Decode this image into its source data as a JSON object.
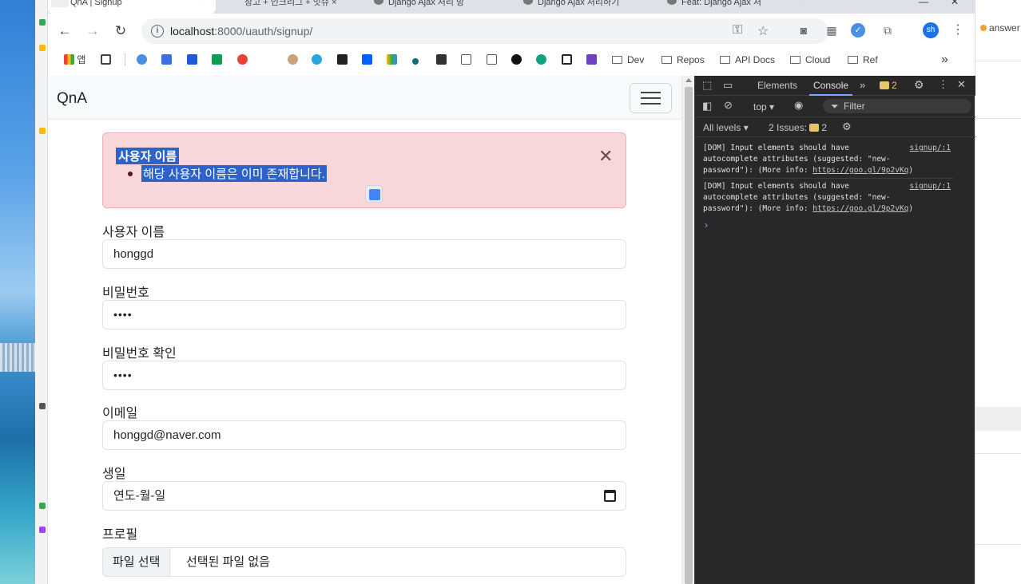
{
  "browser": {
    "tabs": [
      {
        "label": "QnA | Signup",
        "active": true
      },
      {
        "label": "장고 + 인크리그 + 잇슈 ×"
      },
      {
        "label": "Django Ajax 처리 방"
      },
      {
        "label": "Django Ajax 처리하기"
      },
      {
        "label": "Feat: Django Ajax 처"
      }
    ],
    "url_host": "localhost",
    "url_path": ":8000/uauth/signup/",
    "profile_initials": "sh"
  },
  "bookmarks": {
    "apps_label": "앱",
    "folders": [
      "Dev",
      "Repos",
      "API Docs",
      "Cloud",
      "Ref"
    ],
    "overflow": "»"
  },
  "page": {
    "brand": "QnA",
    "alert": {
      "heading": "사용자 이름",
      "message": "해당 사용자 이름은 이미 존재합니다."
    },
    "fields": {
      "username": {
        "label": "사용자 이름",
        "value": "honggd"
      },
      "password": {
        "label": "비밀번호",
        "value": "••••"
      },
      "password_confirm": {
        "label": "비밀번호 확인",
        "value": "••••"
      },
      "email": {
        "label": "이메일",
        "value": "honggd@naver.com"
      },
      "birthday": {
        "label": "생일",
        "value": "연도-월-일"
      },
      "profile": {
        "label": "프로필",
        "button": "파일 선택",
        "status": "선택된 파일 없음"
      }
    }
  },
  "devtools": {
    "tabs": {
      "elements": "Elements",
      "console": "Console"
    },
    "issue_count": "2",
    "context": "top",
    "filter_placeholder": "Filter",
    "levels": "All levels",
    "issues_label": "2 Issues:",
    "messages": [
      {
        "line1": "[DOM] Input elements should have",
        "line2": "autocomplete attributes (suggested: \"new-",
        "line3a": "password\"): (More info: ",
        "link": "https://goo.gl/9p2vKq",
        "line3b": ")",
        "source": "signup/:1"
      },
      {
        "line1": "[DOM] Input elements should have",
        "line2": "autocomplete attributes (suggested: \"new-",
        "line3a": "password\"): (More info: ",
        "link": "https://goo.gl/9p2vKq",
        "line3b": ")",
        "source": "signup/:1"
      }
    ],
    "prompt": "›"
  },
  "background_app": {
    "label": "answer"
  },
  "colors": {
    "alert_bg": "#f8d7da",
    "selection": "#2d63c8",
    "devtools_bg": "#282828",
    "accent": "#7cacf8"
  }
}
